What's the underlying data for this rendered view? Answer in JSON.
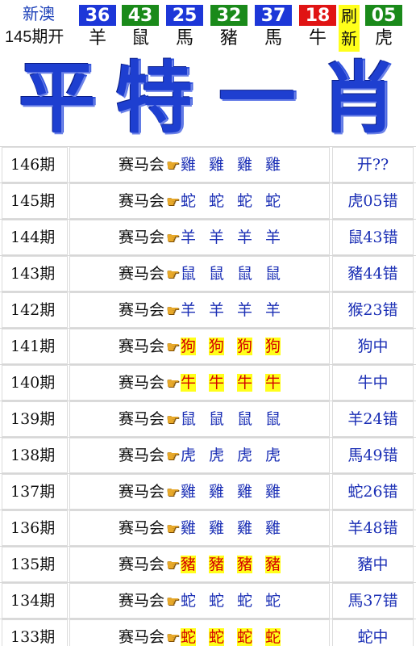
{
  "header": {
    "region": "新澳",
    "period": "145期开",
    "balls": [
      {
        "number": "36",
        "zodiac": "羊",
        "color": "#1d37d8"
      },
      {
        "number": "43",
        "zodiac": "鼠",
        "color": "#1a8a1a"
      },
      {
        "number": "25",
        "zodiac": "馬",
        "color": "#1d37d8"
      },
      {
        "number": "32",
        "zodiac": "豬",
        "color": "#1a8a1a"
      },
      {
        "number": "37",
        "zodiac": "馬",
        "color": "#1d37d8"
      },
      {
        "number": "18",
        "zodiac": "牛",
        "color": "#e01414"
      },
      {
        "number": "05",
        "zodiac": "虎",
        "color": "#1a8a1a"
      }
    ],
    "sep_top": "刷",
    "sep_bottom": "新"
  },
  "banner": {
    "title_chars": [
      "平",
      "特",
      "一",
      "肖"
    ]
  },
  "table": {
    "source_label": "赛马会",
    "pointer_icon": "pointing-hand-icon",
    "rows": [
      {
        "period": "146期",
        "zodiac": "雞",
        "hit": false,
        "result": "开??"
      },
      {
        "period": "145期",
        "zodiac": "蛇",
        "hit": false,
        "result": "虎05错"
      },
      {
        "period": "144期",
        "zodiac": "羊",
        "hit": false,
        "result": "鼠43错"
      },
      {
        "period": "143期",
        "zodiac": "鼠",
        "hit": false,
        "result": "豬44错"
      },
      {
        "period": "142期",
        "zodiac": "羊",
        "hit": false,
        "result": "猴23错"
      },
      {
        "period": "141期",
        "zodiac": "狗",
        "hit": true,
        "result": "狗中"
      },
      {
        "period": "140期",
        "zodiac": "牛",
        "hit": true,
        "result": "牛中"
      },
      {
        "period": "139期",
        "zodiac": "鼠",
        "hit": false,
        "result": "羊24错"
      },
      {
        "period": "138期",
        "zodiac": "虎",
        "hit": false,
        "result": "馬49错"
      },
      {
        "period": "137期",
        "zodiac": "雞",
        "hit": false,
        "result": "蛇26错"
      },
      {
        "period": "136期",
        "zodiac": "雞",
        "hit": false,
        "result": "羊48错"
      },
      {
        "period": "135期",
        "zodiac": "豬",
        "hit": true,
        "result": "豬中"
      },
      {
        "period": "134期",
        "zodiac": "蛇",
        "hit": false,
        "result": "馬37错"
      },
      {
        "period": "133期",
        "zodiac": "蛇",
        "hit": true,
        "result": "蛇中"
      }
    ]
  }
}
